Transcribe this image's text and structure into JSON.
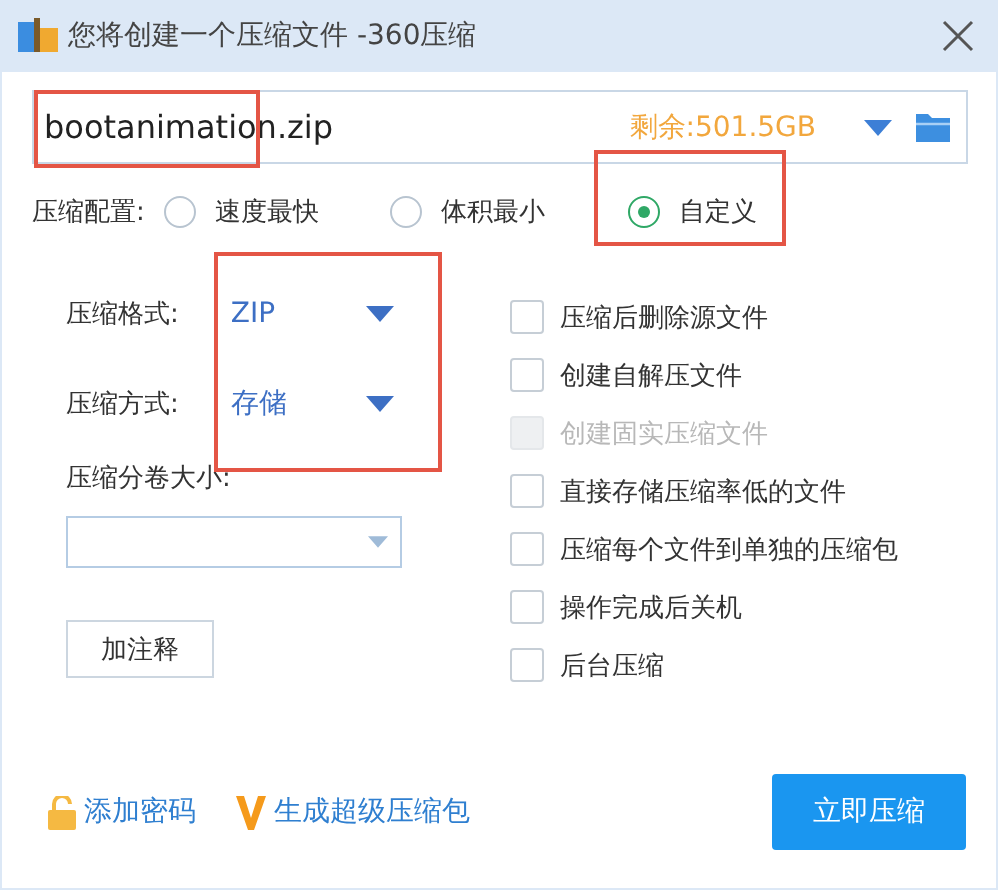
{
  "window": {
    "title": "您将创建一个压缩文件 -360压缩"
  },
  "file": {
    "value": "bootanimation.zip",
    "free_space": "剩余:501.5GB",
    "highlighted": true
  },
  "profile": {
    "label": "压缩配置:",
    "options": [
      {
        "label": "速度最快",
        "selected": false,
        "highlighted": false
      },
      {
        "label": "体积最小",
        "selected": false,
        "highlighted": false
      },
      {
        "label": "自定义",
        "selected": true,
        "highlighted": true
      }
    ]
  },
  "settings": {
    "highlighted": true,
    "fields": [
      {
        "label": "压缩格式:",
        "value": "ZIP"
      },
      {
        "label": "压缩方式:",
        "value": "存储"
      }
    ]
  },
  "split": {
    "label": "压缩分卷大小:"
  },
  "comment_button": "加注释",
  "options": [
    {
      "label": "压缩后删除源文件",
      "checked": false,
      "disabled": false
    },
    {
      "label": "创建自解压文件",
      "checked": false,
      "disabled": false
    },
    {
      "label": "创建固实压缩文件",
      "checked": false,
      "disabled": true
    },
    {
      "label": "直接存储压缩率低的文件",
      "checked": false,
      "disabled": false
    },
    {
      "label": "压缩每个文件到单独的压缩包",
      "checked": false,
      "disabled": false
    },
    {
      "label": "操作完成后关机",
      "checked": false,
      "disabled": false
    },
    {
      "label": "后台压缩",
      "checked": false,
      "disabled": false
    }
  ],
  "footer": {
    "links": [
      {
        "kind": "lock",
        "label": "添加密码"
      },
      {
        "kind": "v",
        "label": "生成超级压缩包"
      }
    ],
    "primary_button": "立即压缩"
  }
}
